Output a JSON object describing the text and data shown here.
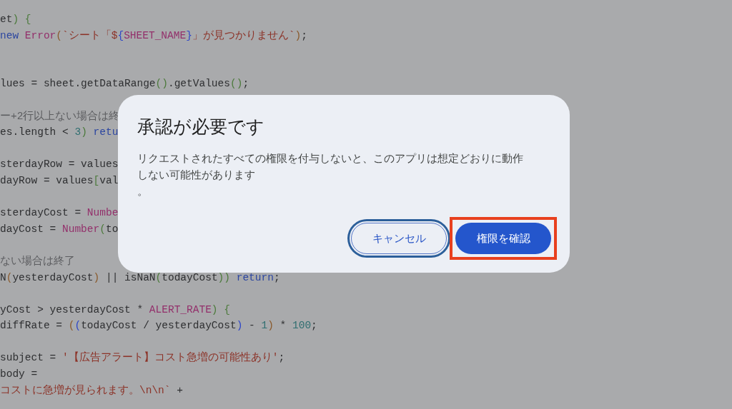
{
  "code_lines": [
    {
      "kind": "code",
      "tokens": [
        {
          "kind": "plain",
          "text": "et"
        },
        {
          "kind": "paren",
          "text": ") {"
        }
      ]
    },
    {
      "kind": "code",
      "tokens": [
        {
          "kind": "keyword",
          "text": "new "
        },
        {
          "kind": "call",
          "text": "Error"
        },
        {
          "kind": "bracket",
          "text": "("
        },
        {
          "kind": "string",
          "text": "`シート「$"
        },
        {
          "kind": "brace",
          "text": "{"
        },
        {
          "kind": "call",
          "text": "SHEET_NAME"
        },
        {
          "kind": "brace",
          "text": "}"
        },
        {
          "kind": "string",
          "text": "」が見つかりません`"
        },
        {
          "kind": "bracket",
          "text": ")"
        },
        {
          "kind": "plain",
          "text": ";"
        }
      ]
    },
    {
      "kind": "blank"
    },
    {
      "kind": "blank"
    },
    {
      "kind": "code",
      "tokens": [
        {
          "kind": "plain",
          "text": "lues = sheet.getDataRange"
        },
        {
          "kind": "paren",
          "text": "()"
        },
        {
          "kind": "plain",
          "text": ".getValues"
        },
        {
          "kind": "paren",
          "text": "()"
        },
        {
          "kind": "plain",
          "text": ";"
        }
      ]
    },
    {
      "kind": "blank"
    },
    {
      "kind": "code",
      "tokens": [
        {
          "kind": "comment",
          "text": "ー+2行以上ない場合は終"
        }
      ]
    },
    {
      "kind": "code",
      "tokens": [
        {
          "kind": "plain",
          "text": "es.length < "
        },
        {
          "kind": "number",
          "text": "3"
        },
        {
          "kind": "paren",
          "text": ")"
        },
        {
          "kind": "keyword",
          "text": " retu"
        }
      ]
    },
    {
      "kind": "blank"
    },
    {
      "kind": "code",
      "tokens": [
        {
          "kind": "plain",
          "text": "sterdayRow = values"
        }
      ]
    },
    {
      "kind": "code",
      "tokens": [
        {
          "kind": "plain",
          "text": "dayRow = values"
        },
        {
          "kind": "paren",
          "text": "["
        },
        {
          "kind": "plain",
          "text": "val"
        }
      ]
    },
    {
      "kind": "blank"
    },
    {
      "kind": "code",
      "tokens": [
        {
          "kind": "plain",
          "text": "sterdayCost = "
        },
        {
          "kind": "call",
          "text": "Numbe"
        }
      ]
    },
    {
      "kind": "code",
      "tokens": [
        {
          "kind": "plain",
          "text": "dayCost = "
        },
        {
          "kind": "call",
          "text": "Number"
        },
        {
          "kind": "paren",
          "text": "("
        },
        {
          "kind": "plain",
          "text": "to"
        }
      ]
    },
    {
      "kind": "blank"
    },
    {
      "kind": "code",
      "tokens": [
        {
          "kind": "comment",
          "text": "ない場合は終了"
        }
      ]
    },
    {
      "kind": "code",
      "tokens": [
        {
          "kind": "plain",
          "text": "N"
        },
        {
          "kind": "bracket",
          "text": "("
        },
        {
          "kind": "plain",
          "text": "yesterdayCost"
        },
        {
          "kind": "bracket",
          "text": ")"
        },
        {
          "kind": "plain",
          "text": " || isNaN"
        },
        {
          "kind": "paren",
          "text": "("
        },
        {
          "kind": "plain",
          "text": "todayCost"
        },
        {
          "kind": "paren",
          "text": "))"
        },
        {
          "kind": "keyword",
          "text": " return"
        },
        {
          "kind": "plain",
          "text": ";"
        }
      ]
    },
    {
      "kind": "blank"
    },
    {
      "kind": "code",
      "tokens": [
        {
          "kind": "plain",
          "text": "yCost > yesterdayCost * "
        },
        {
          "kind": "call",
          "text": "ALERT_RATE"
        },
        {
          "kind": "paren",
          "text": ") {"
        }
      ]
    },
    {
      "kind": "code",
      "tokens": [
        {
          "kind": "plain",
          "text": "diffRate = "
        },
        {
          "kind": "bracket",
          "text": "("
        },
        {
          "kind": "brace",
          "text": "("
        },
        {
          "kind": "plain",
          "text": "todayCost / yesterdayCost"
        },
        {
          "kind": "brace",
          "text": ")"
        },
        {
          "kind": "plain",
          "text": " - "
        },
        {
          "kind": "number",
          "text": "1"
        },
        {
          "kind": "bracket",
          "text": ")"
        },
        {
          "kind": "plain",
          "text": " * "
        },
        {
          "kind": "number",
          "text": "100"
        },
        {
          "kind": "plain",
          "text": ";"
        }
      ]
    },
    {
      "kind": "blank"
    },
    {
      "kind": "code",
      "tokens": [
        {
          "kind": "plain",
          "text": "subject = "
        },
        {
          "kind": "string",
          "text": "'【広告アラート】コスト急増の可能性あり'"
        },
        {
          "kind": "plain",
          "text": ";"
        }
      ]
    },
    {
      "kind": "code",
      "tokens": [
        {
          "kind": "plain",
          "text": "body ="
        }
      ]
    },
    {
      "kind": "code",
      "tokens": [
        {
          "kind": "string",
          "text": "コストに急増が見られます。\\n\\n`"
        },
        {
          "kind": "plain",
          "text": " +"
        }
      ]
    }
  ],
  "dialog": {
    "title": "承認が必要です",
    "message_lines": [
      "リクエストされたすべての権限を付与しないと、このアプリは想定どおりに動作",
      "しない可能性があります",
      "。"
    ],
    "buttons": [
      {
        "kind": "secondary",
        "label": "キャンセル",
        "focused": true,
        "highlighted": false
      },
      {
        "kind": "primary",
        "label": "権限を確認",
        "focused": false,
        "highlighted": true
      }
    ]
  }
}
